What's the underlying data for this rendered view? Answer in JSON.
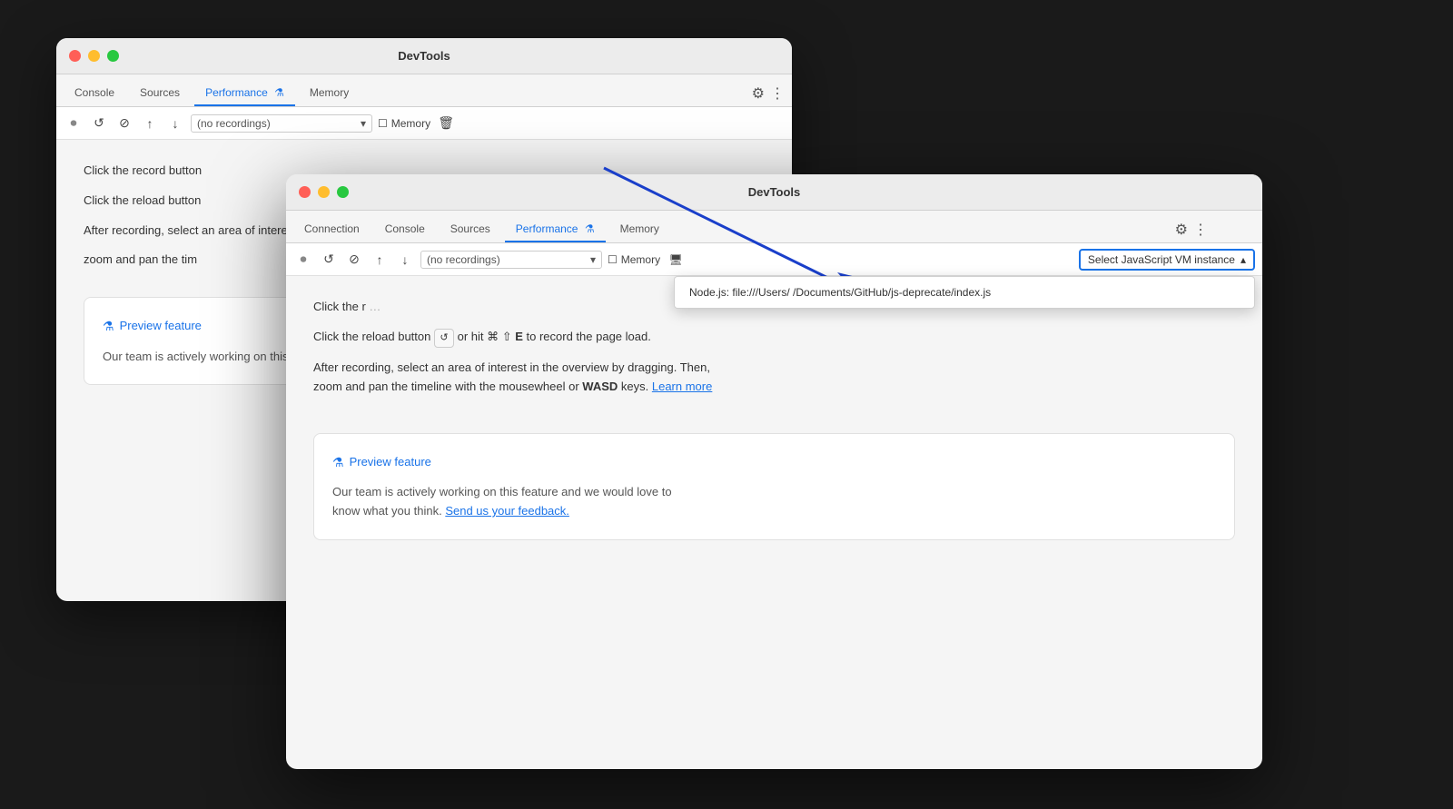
{
  "back_window": {
    "title": "DevTools",
    "tabs": [
      {
        "label": "Console",
        "active": false
      },
      {
        "label": "Sources",
        "active": false
      },
      {
        "label": "Performance",
        "active": true
      },
      {
        "label": "Memory",
        "active": false
      }
    ],
    "toolbar": {
      "recordings_placeholder": "no recordings",
      "memory_label": "Memory"
    },
    "content": {
      "line1": "Click the record button",
      "line2": "Click the reload button",
      "line3": "After recording, select an area of interest in the overview by dragging. Then,",
      "line4": "zoom and pan the tim"
    },
    "preview_box": {
      "title": "Preview feature",
      "text": "Our team is actively working on this feature and we would love to\nknow what you thin"
    }
  },
  "front_window": {
    "title": "DevTools",
    "tabs": [
      {
        "label": "Connection",
        "active": false
      },
      {
        "label": "Console",
        "active": false
      },
      {
        "label": "Sources",
        "active": false
      },
      {
        "label": "Performance",
        "active": true
      },
      {
        "label": "Memory",
        "active": false
      }
    ],
    "toolbar": {
      "recordings_placeholder": "no recordings",
      "memory_label": "Memory",
      "vm_selector_label": "Select JavaScript VM instance"
    },
    "vm_dropdown": {
      "item": "Node.js: file:///Users/        /Documents/GitHub/js-deprecate/index.js"
    },
    "content": {
      "line1_prefix": "Click the r",
      "line2": "Click the reload button",
      "line2_shortcut": "or hit ⌘ ⇧ E to record the page load.",
      "line3": "After recording, select an area of interest in the overview by dragging. Then,",
      "line4_prefix": "zoom and pan the timeline with the mousewheel or ",
      "line4_bold": "WASD",
      "line4_suffix": " keys.",
      "line4_link": "Learn more"
    },
    "preview_box": {
      "title": "Preview feature",
      "text1": "Our team is actively working on this feature and we would love to",
      "text2": "know what you think.",
      "link": "Send us your feedback."
    }
  },
  "icons": {
    "record": "⏺",
    "reload": "↺",
    "stop": "⊘",
    "upload": "↑",
    "download": "↓",
    "delete": "🗑",
    "gear": "⚙",
    "more": "⋮",
    "chevron_down": "▾",
    "chevron_up": "▴",
    "flask": "⚗",
    "chip": "🖥"
  }
}
